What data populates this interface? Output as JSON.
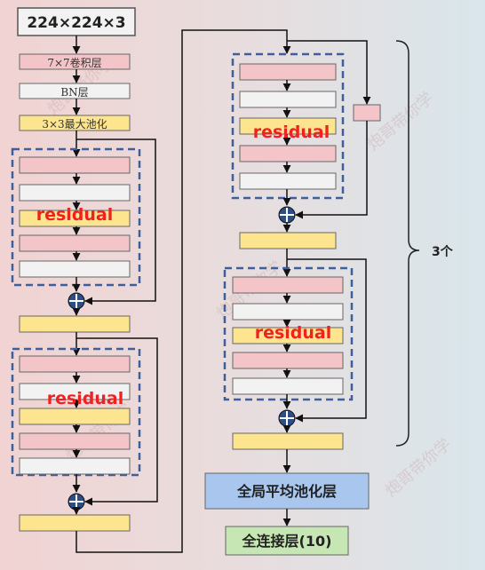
{
  "input_label": "224×224×3",
  "conv_label": "7×7卷积层",
  "bn_label": "BN层",
  "pool_label": "3×3最大池化",
  "residual_label": "residual",
  "repeat_label": "3个",
  "gap_label": "全局平均池化层",
  "fc_label": "全连接层(10)",
  "watermark_text": "炮哥带你学",
  "colors": {
    "pink": "#f3c4c8",
    "white": "#f2f2f2",
    "yellow": "#fde48f",
    "blue": "#a9c6ee",
    "green": "#c6e7b4",
    "dash": "#3d5f9b",
    "residual_text": "#ee2222"
  }
}
